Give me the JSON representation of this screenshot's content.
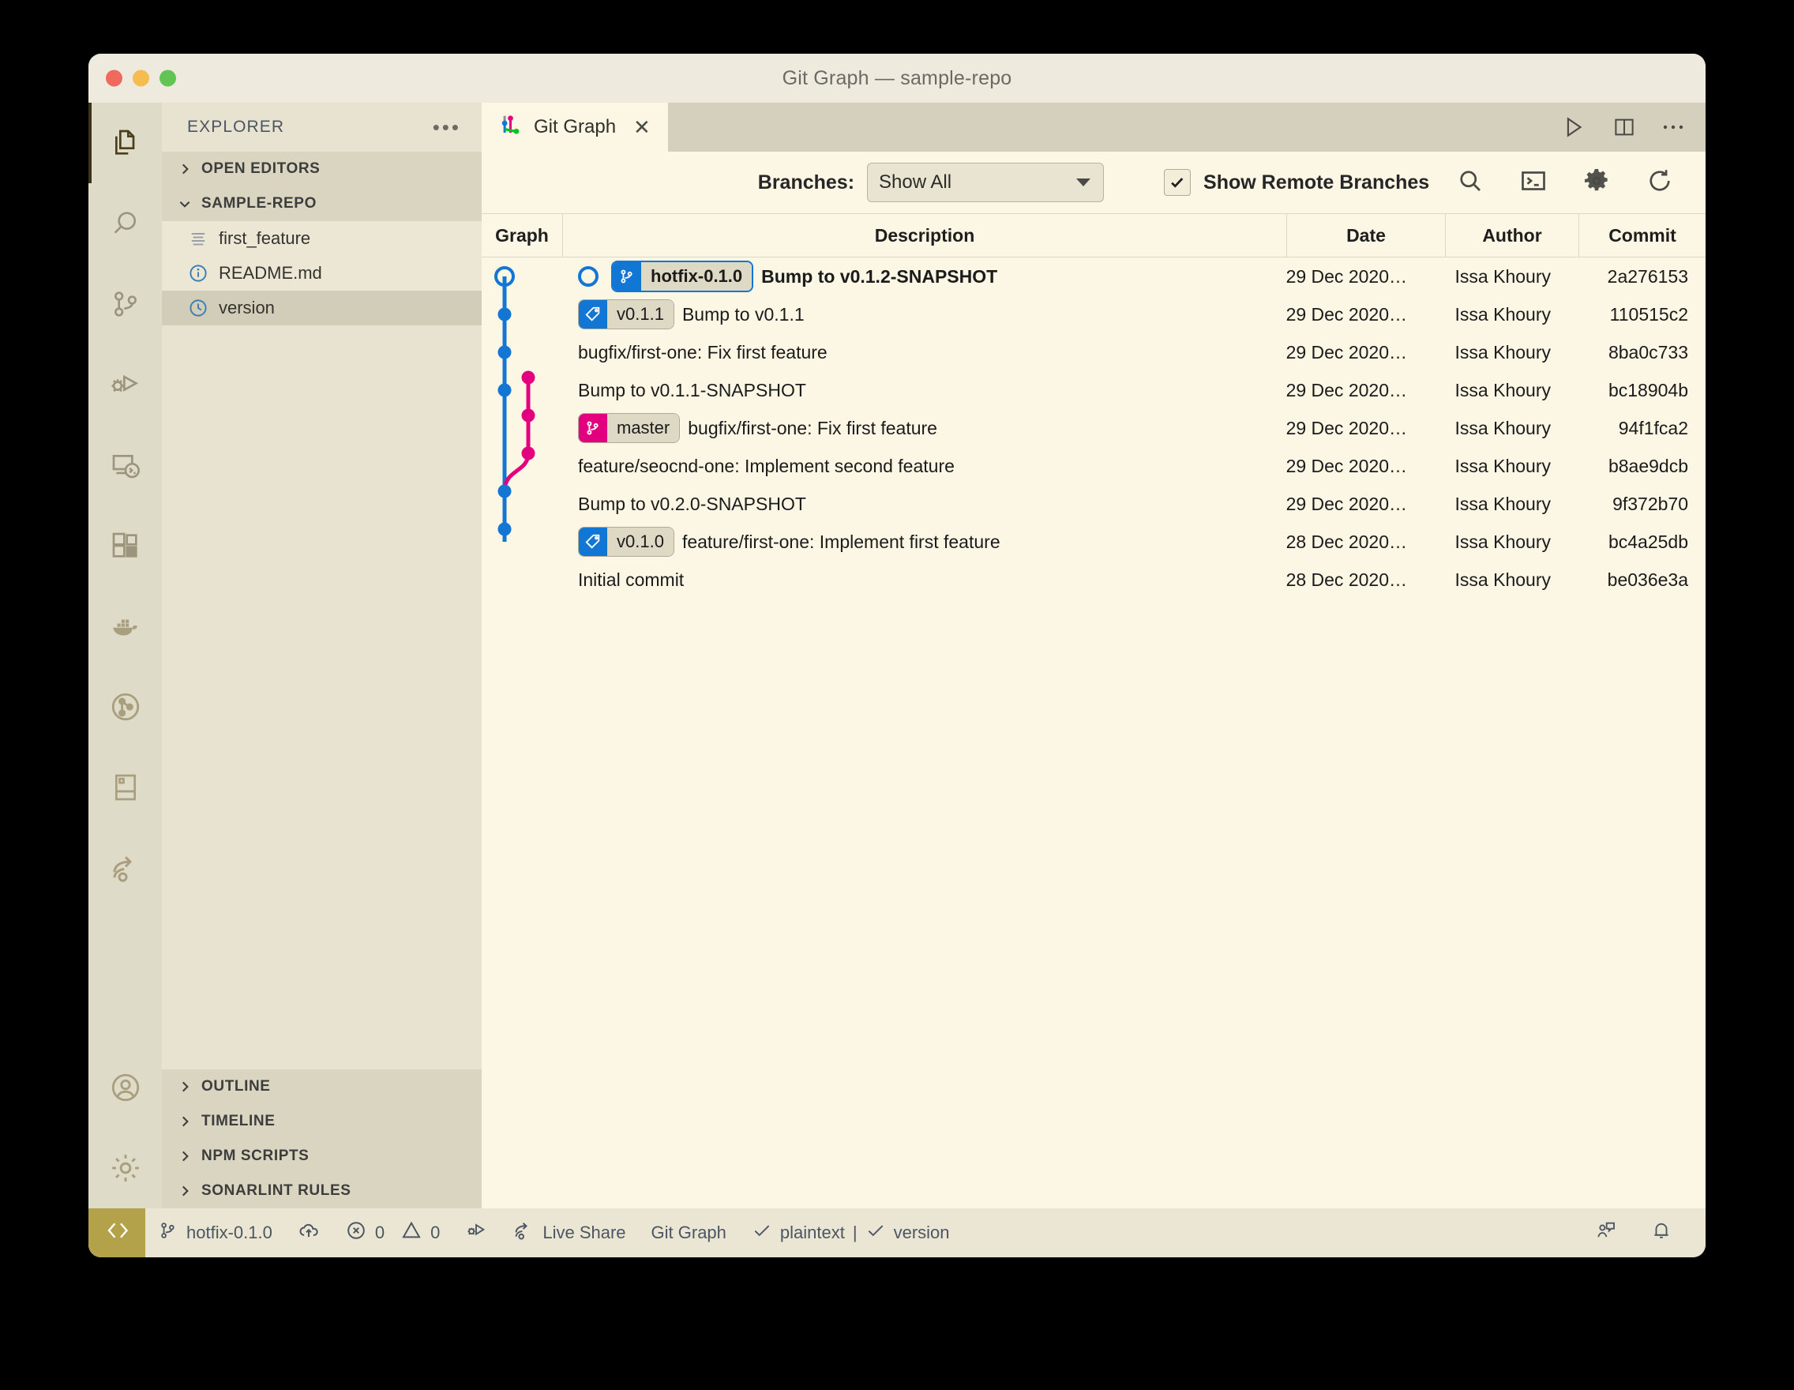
{
  "window": {
    "title": "Git Graph — sample-repo"
  },
  "activitybar": {
    "items": [
      {
        "name": "explorer",
        "icon": "files-icon",
        "active": true
      },
      {
        "name": "search",
        "icon": "search-icon",
        "active": false
      },
      {
        "name": "source-control",
        "icon": "source-control-icon",
        "active": false
      },
      {
        "name": "run-debug",
        "icon": "run-and-debug-icon",
        "active": false
      },
      {
        "name": "remote-explorer",
        "icon": "remote-explorer-icon",
        "active": false
      },
      {
        "name": "extensions",
        "icon": "extensions-icon",
        "active": false
      },
      {
        "name": "docker",
        "icon": "docker-whale-icon",
        "active": false
      },
      {
        "name": "gitlens",
        "icon": "gitlens-icon",
        "active": false
      },
      {
        "name": "todo-tree",
        "icon": "panel-layout-icon",
        "active": false
      },
      {
        "name": "live-share",
        "icon": "live-share-icon",
        "active": false
      },
      {
        "name": "accounts",
        "icon": "account-icon",
        "active": false
      },
      {
        "name": "settings",
        "icon": "gear-icon",
        "active": false
      }
    ]
  },
  "sidebar": {
    "title": "EXPLORER",
    "more_label": "•••",
    "sections_top": [
      {
        "label": "OPEN EDITORS",
        "expanded": false
      },
      {
        "label": "SAMPLE-REPO",
        "expanded": true
      }
    ],
    "files": [
      {
        "label": "first_feature",
        "icon": "lines-file-icon",
        "selected": false
      },
      {
        "label": "README.md",
        "icon": "info-file-icon",
        "selected": false
      },
      {
        "label": "version",
        "icon": "clock-file-icon",
        "selected": true
      }
    ],
    "sections_bottom": [
      {
        "label": "OUTLINE",
        "expanded": false
      },
      {
        "label": "TIMELINE",
        "expanded": false
      },
      {
        "label": "NPM SCRIPTS",
        "expanded": false
      },
      {
        "label": "SONARLINT RULES",
        "expanded": false
      }
    ]
  },
  "editor": {
    "tab": {
      "label": "Git Graph",
      "icon": "git-graph-icon",
      "close_label": "✕"
    },
    "actions": [
      {
        "name": "run-icon"
      },
      {
        "name": "split-editor-icon"
      },
      {
        "name": "more-actions-icon",
        "label": "•••"
      }
    ]
  },
  "gitgraph": {
    "toolbar": {
      "branches_label": "Branches:",
      "branches_value": "Show All",
      "remote_checkbox_checked": true,
      "remote_label": "Show Remote Branches",
      "icons": [
        {
          "name": "search-icon"
        },
        {
          "name": "terminal-icon"
        },
        {
          "name": "gear-icon"
        },
        {
          "name": "refresh-icon"
        }
      ]
    },
    "columns": [
      "Graph",
      "Description",
      "Date",
      "Author",
      "Commit"
    ],
    "commits": [
      {
        "badges": [
          {
            "type": "head",
            "label": "hotfix-0.1.0",
            "icon": "branch-icon"
          }
        ],
        "description": "Bump to v0.1.2-SNAPSHOT",
        "bold": true,
        "date": "29 Dec 2020…",
        "author": "Issa Khoury",
        "commit": "2a276153"
      },
      {
        "badges": [
          {
            "type": "tag",
            "label": "v0.1.1",
            "icon": "tag-icon"
          }
        ],
        "description": "Bump to v0.1.1",
        "bold": false,
        "date": "29 Dec 2020…",
        "author": "Issa Khoury",
        "commit": "110515c2"
      },
      {
        "badges": [],
        "description": "bugfix/first-one: Fix first feature",
        "bold": false,
        "date": "29 Dec 2020…",
        "author": "Issa Khoury",
        "commit": "8ba0c733"
      },
      {
        "badges": [],
        "description": "Bump to v0.1.1-SNAPSHOT",
        "bold": false,
        "date": "29 Dec 2020…",
        "author": "Issa Khoury",
        "commit": "bc18904b"
      },
      {
        "badges": [
          {
            "type": "master",
            "label": "master",
            "icon": "branch-icon"
          }
        ],
        "description": "bugfix/first-one: Fix first feature",
        "bold": false,
        "date": "29 Dec 2020…",
        "author": "Issa Khoury",
        "commit": "94f1fca2"
      },
      {
        "badges": [],
        "description": "feature/seocnd-one: Implement second feature",
        "bold": false,
        "date": "29 Dec 2020…",
        "author": "Issa Khoury",
        "commit": "b8ae9dcb"
      },
      {
        "badges": [],
        "description": "Bump to v0.2.0-SNAPSHOT",
        "bold": false,
        "date": "29 Dec 2020…",
        "author": "Issa Khoury",
        "commit": "9f372b70"
      },
      {
        "badges": [
          {
            "type": "tag",
            "label": "v0.1.0",
            "icon": "tag-icon"
          }
        ],
        "description": "feature/first-one: Implement first feature",
        "bold": false,
        "date": "28 Dec 2020…",
        "author": "Issa Khoury",
        "commit": "bc4a25db"
      },
      {
        "badges": [],
        "description": "Initial commit",
        "bold": false,
        "date": "28 Dec 2020…",
        "author": "Issa Khoury",
        "commit": "be036e3a"
      }
    ],
    "graph": {
      "blue_color": "#1277d4",
      "magenta_color": "#e2007f"
    }
  },
  "statusbar": {
    "remote_icon": "remote-window-icon",
    "branch": "hotfix-0.1.0",
    "sync_icon": "cloud-upload-icon",
    "errors": "0",
    "warnings": "0",
    "debug_icon": "debug-alt-icon",
    "live_share": "Live Share",
    "git_graph": "Git Graph",
    "language": "plaintext",
    "separator": "|",
    "file": "version",
    "feedback_icon": "feedback-icon",
    "bell_icon": "bell-icon"
  }
}
